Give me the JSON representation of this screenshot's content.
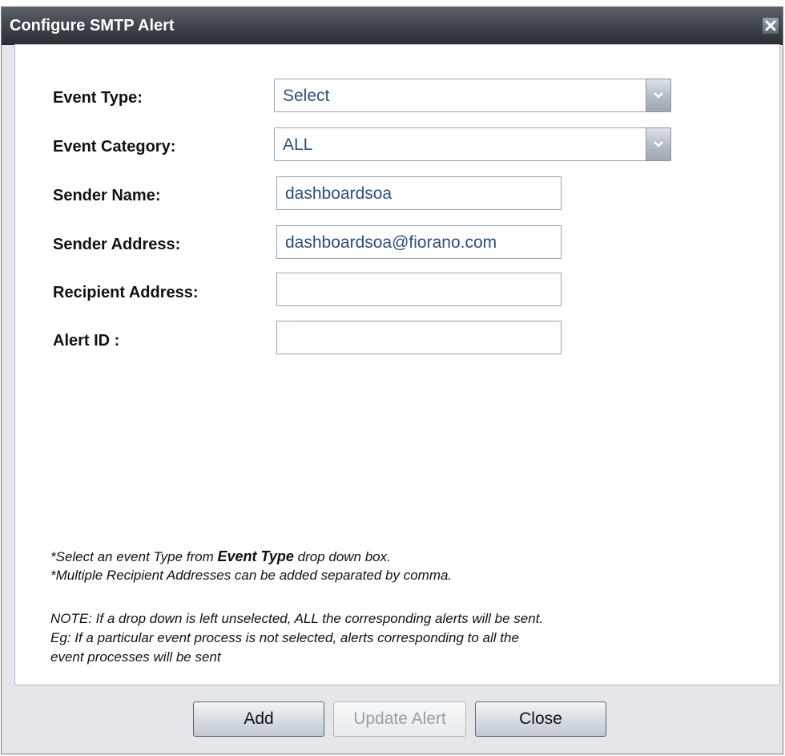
{
  "window": {
    "title": "Configure SMTP Alert",
    "close_icon": "close-x-icon"
  },
  "form": {
    "event_type": {
      "label": "Event Type:",
      "value": "Select"
    },
    "event_category": {
      "label": "Event Category:",
      "value": "ALL"
    },
    "sender_name": {
      "label": "Sender Name:",
      "value": "dashboardsoa"
    },
    "sender_address": {
      "label": "Sender Address:",
      "value": "dashboardsoa@fiorano.com"
    },
    "recipient_address": {
      "label": "Recipient Address:",
      "value": ""
    },
    "alert_id": {
      "label": "Alert ID :",
      "value": ""
    }
  },
  "notes": {
    "line1_prefix": "*Select an event Type from ",
    "line1_bold": "Event Type",
    "line1_suffix": " drop down box.",
    "line2": "*Multiple Recipient Addresses can be added separated by comma.",
    "line3": "NOTE: If a drop down is left unselected, ALL the corresponding alerts will be sent.",
    "line4": "Eg: If a particular event process is not selected, alerts corresponding to all the",
    "line5": "event processes will be sent"
  },
  "buttons": {
    "add": "Add",
    "update_alert": "Update Alert",
    "close": "Close"
  },
  "colors": {
    "title_bar": "#3e4249",
    "field_text": "#2d4f7e",
    "disabled_text": "#9aa0a7"
  }
}
